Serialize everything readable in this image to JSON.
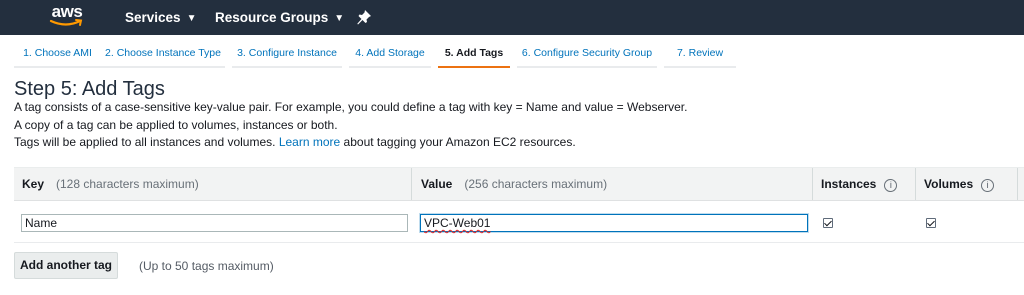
{
  "topnav": {
    "logo_text": "aws",
    "services": "Services",
    "resource_groups": "Resource Groups"
  },
  "wizard": {
    "steps": [
      {
        "label": "1. Choose AMI",
        "active": false
      },
      {
        "label": "2. Choose Instance Type",
        "active": false
      },
      {
        "label": "3. Configure Instance",
        "active": false
      },
      {
        "label": "4. Add Storage",
        "active": false
      },
      {
        "label": "5. Add Tags",
        "active": true
      },
      {
        "label": "6. Configure Security Group",
        "active": false
      },
      {
        "label": "7. Review",
        "active": false
      }
    ]
  },
  "page": {
    "title": "Step 5: Add Tags",
    "line1": "A tag consists of a case-sensitive key-value pair. For example, you could define a tag with key = Name and value = Webserver.",
    "line2": "A copy of a tag can be applied to volumes, instances or both.",
    "line3_before": "Tags will be applied to all instances and volumes.",
    "line3_link": "Learn more",
    "line3_after": "about tagging your Amazon EC2 resources."
  },
  "table": {
    "headers": {
      "key": "Key",
      "key_hint": "(128 characters maximum)",
      "value": "Value",
      "value_hint": "(256 characters maximum)",
      "instances": "Instances",
      "volumes": "Volumes"
    },
    "info_glyph": "i",
    "rows": [
      {
        "key": "Name",
        "value": "VPC-Web01",
        "instances": true,
        "volumes": true
      }
    ]
  },
  "actions": {
    "add_tag": "Add another tag",
    "add_tag_hint": "(Up to 50 tags maximum)"
  },
  "colors": {
    "nav_bg": "#232f3e",
    "active_step": "#ec7211",
    "link": "#0073bb"
  },
  "icons": {
    "logo": "aws-logo",
    "services_caret": "chevron-down-icon",
    "resource_groups_caret": "chevron-down-icon",
    "pin": "pin-icon",
    "info": "info-icon"
  }
}
